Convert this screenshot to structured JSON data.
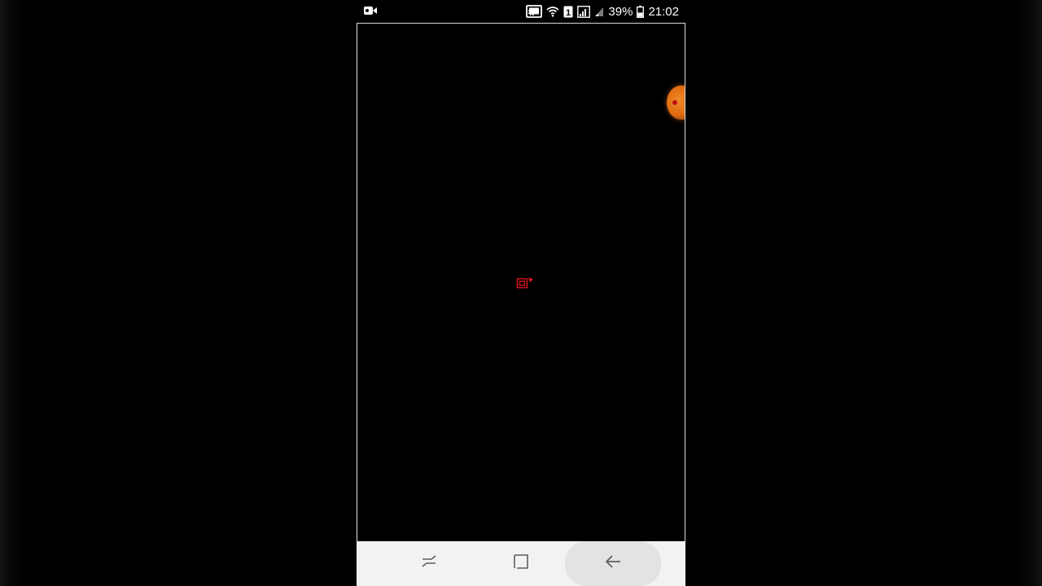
{
  "status_bar": {
    "battery_percent": "39%",
    "time": "21:02",
    "left_icon": "video-recording-icon",
    "icons": [
      "cast-icon",
      "wifi-icon",
      "sim-1-icon",
      "signal-icon",
      "signal-weak-icon",
      "battery-icon"
    ]
  },
  "screen": {
    "background": "#000000",
    "floating_bubble": "orange-bubble",
    "center_icon": "red-cursor-icon"
  },
  "nav_bar": {
    "background": "#f2f2f2",
    "buttons": [
      "recent-apps-icon",
      "home-icon",
      "back-icon"
    ]
  }
}
